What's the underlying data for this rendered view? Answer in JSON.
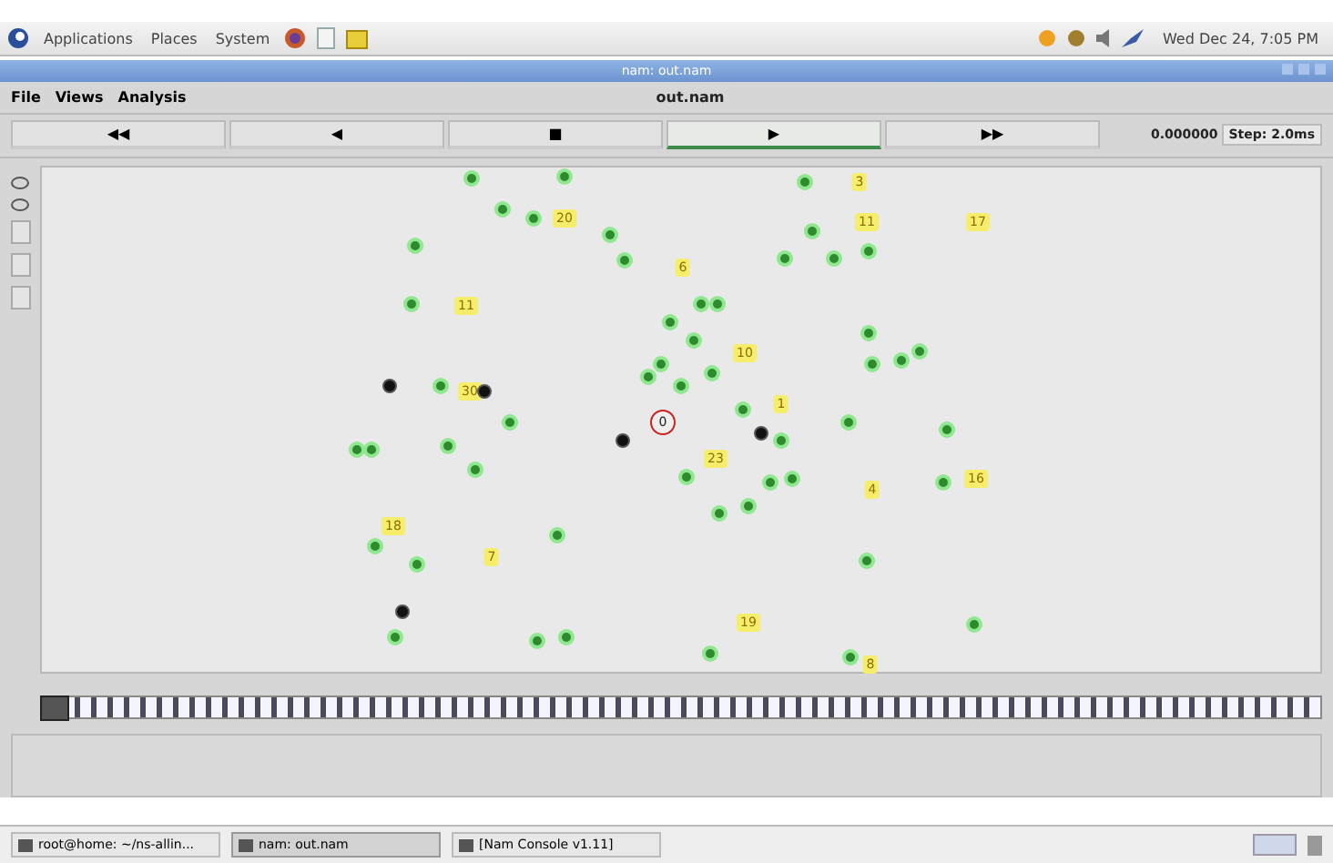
{
  "top_panel": {
    "menus": [
      "Applications",
      "Places",
      "System"
    ],
    "clock": "Wed Dec 24, 7:05 PM"
  },
  "window": {
    "title": "nam: out.nam",
    "menu": [
      "File",
      "Views",
      "Analysis"
    ],
    "file_name": "out.nam",
    "controls": [
      {
        "symbol": "◀◀",
        "selected": false
      },
      {
        "symbol": "◀",
        "selected": false
      },
      {
        "symbol": "■",
        "selected": false
      },
      {
        "symbol": "▶",
        "selected": true
      },
      {
        "symbol": "▶▶",
        "selected": false
      }
    ],
    "time": "0.000000",
    "step": "Step: 2.0ms"
  },
  "canvas": {
    "nodes": [
      {
        "kind": "sensor"
      },
      {
        "kind": "sensor"
      },
      {
        "kind": "sensor"
      },
      {
        "kind": "sensor"
      },
      {
        "kind": "sensor"
      },
      {
        "kind": "sensor"
      },
      {
        "kind": "sensor"
      },
      {
        "kind": "sensor"
      },
      {
        "kind": "sensor"
      },
      {
        "kind": "sensor"
      },
      {
        "kind": "sensor"
      },
      {
        "kind": "sensor"
      },
      {
        "kind": "sensor"
      },
      {
        "kind": "sensor"
      },
      {
        "kind": "sensor"
      },
      {
        "kind": "sensor"
      },
      {
        "kind": "sensor"
      },
      {
        "kind": "sensor"
      },
      {
        "kind": "sensor"
      },
      {
        "kind": "sensor"
      },
      {
        "kind": "sensor"
      },
      {
        "kind": "sensor"
      },
      {
        "kind": "sensor"
      },
      {
        "kind": "sensor"
      },
      {
        "kind": "sensor"
      },
      {
        "kind": "sensor"
      },
      {
        "kind": "sensor"
      },
      {
        "kind": "sensor"
      },
      {
        "kind": "sensor"
      },
      {
        "kind": "sensor"
      },
      {
        "kind": "sensor"
      },
      {
        "kind": "sensor"
      },
      {
        "kind": "sensor"
      },
      {
        "kind": "sensor"
      },
      {
        "kind": "sensor"
      },
      {
        "kind": "sensor"
      },
      {
        "kind": "sensor"
      },
      {
        "kind": "sensor"
      },
      {
        "kind": "sensor"
      },
      {
        "kind": "sensor"
      },
      {
        "kind": "sensor"
      },
      {
        "kind": "sensor"
      },
      {
        "kind": "sensor"
      },
      {
        "kind": "sensor"
      },
      {
        "kind": "sensor"
      },
      {
        "kind": "sensor"
      },
      {
        "kind": "sensor"
      },
      {
        "kind": "sensor"
      },
      {
        "kind": "sensor"
      },
      {
        "kind": "sensor"
      },
      {
        "kind": "sensor"
      },
      {
        "kind": "cluster",
        "label": "20"
      },
      {
        "kind": "cluster",
        "label": "6"
      },
      {
        "kind": "cluster",
        "label": "3"
      },
      {
        "kind": "cluster",
        "label": "11"
      },
      {
        "kind": "cluster",
        "label": "17"
      },
      {
        "kind": "cluster",
        "label": "11"
      },
      {
        "kind": "cluster",
        "label": "10"
      },
      {
        "kind": "cluster",
        "label": "1"
      },
      {
        "kind": "cluster",
        "label": "23"
      },
      {
        "kind": "cluster",
        "label": "4"
      },
      {
        "kind": "cluster",
        "label": "16"
      },
      {
        "kind": "cluster",
        "label": "18"
      },
      {
        "kind": "cluster",
        "label": "7"
      },
      {
        "kind": "cluster",
        "label": "19"
      },
      {
        "kind": "cluster",
        "label": "8"
      },
      {
        "kind": "cluster",
        "label": "30"
      },
      {
        "kind": "gateway"
      },
      {
        "kind": "gateway"
      },
      {
        "kind": "gateway"
      },
      {
        "kind": "gateway"
      },
      {
        "kind": "gateway"
      },
      {
        "kind": "sink",
        "label": "0"
      }
    ]
  },
  "timeline": {
    "level": 0.01
  },
  "taskbar": {
    "items": [
      {
        "label": "root@home: ~/ns-allin...",
        "selected": false
      },
      {
        "label": "nam: out.nam",
        "selected": true
      },
      {
        "label": "[Nam Console v1.11]",
        "selected": false
      }
    ]
  }
}
